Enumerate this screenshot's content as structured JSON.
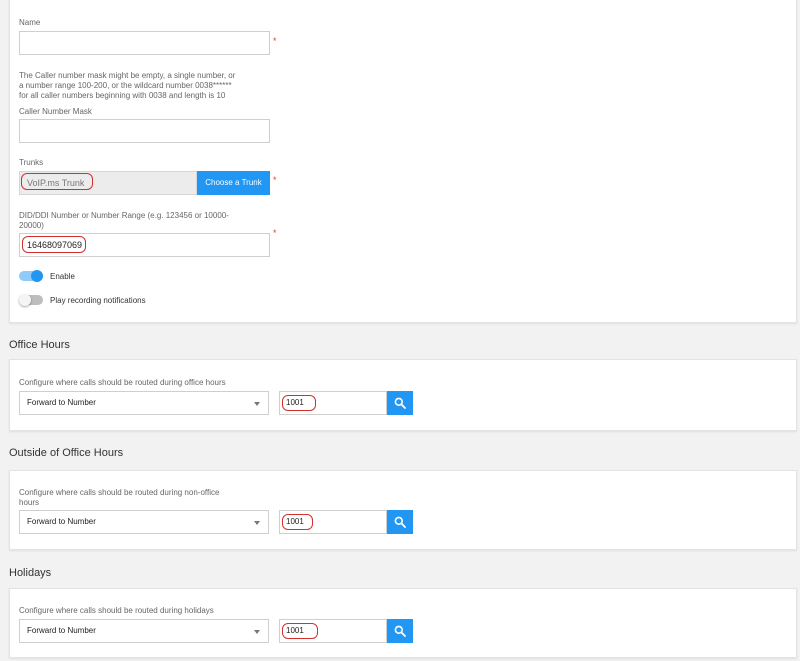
{
  "general": {
    "name_label": "Name",
    "name_value": "",
    "required_marker": "*",
    "mask_hint_line1": "The Caller number mask might be empty, a single number, or",
    "mask_hint_line2": "a number range 100-200, or the wildcard number 0038******",
    "mask_hint_line3": "for all caller numbers beginning with 0038 and length is 10",
    "mask_label": "Caller Number Mask",
    "mask_value": "",
    "trunks_label": "Trunks",
    "trunk_value": "VoIP.ms Trunk",
    "choose_trunk_button": "Choose a Trunk",
    "did_label_line1": "DID/DDI Number or Number Range (e.g. 123456 or 10000-",
    "did_label_line2": "20000)",
    "did_value": "16468097069",
    "enable_label": "Enable",
    "enable_on": true,
    "recording_label": "Play recording notifications",
    "recording_on": false
  },
  "office_hours": {
    "title": "Office Hours",
    "hint": "Configure where calls should be routed during office hours",
    "route_value": "Forward to Number",
    "number_value": "1001"
  },
  "outside_hours": {
    "title": "Outside of Office Hours",
    "hint_line1": "Configure where calls should be routed during non-office",
    "hint_line2": "hours",
    "route_value": "Forward to Number",
    "number_value": "1001"
  },
  "holidays": {
    "title": "Holidays",
    "hint": "Configure where calls should be routed during holidays",
    "route_value": "Forward to Number",
    "number_value": "1001"
  },
  "colors": {
    "accent": "#2196f3",
    "required": "#e53935",
    "highlight_circle": "#d32f2f"
  }
}
